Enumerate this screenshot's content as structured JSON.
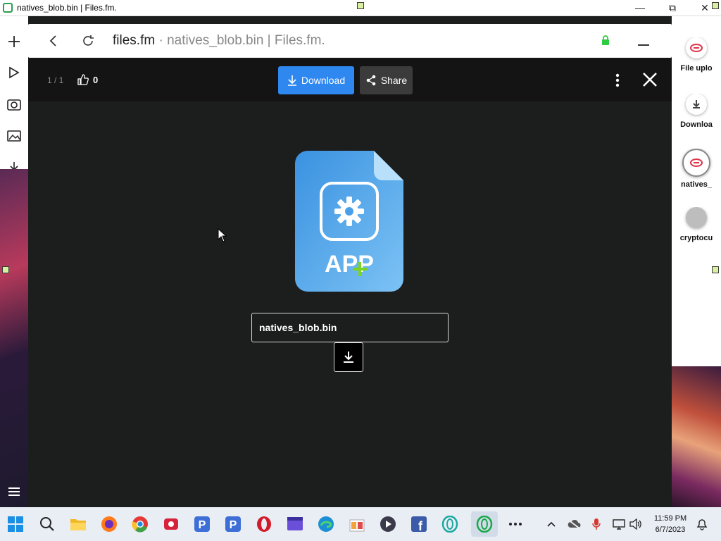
{
  "window": {
    "title": "natives_blob.bin | Files.fm."
  },
  "address_bar": {
    "domain": "files.fm",
    "separator": " · ",
    "page_title": "natives_blob.bin | Files.fm."
  },
  "viewer": {
    "counter": "1 / 1",
    "likes": "0",
    "download_label": "Download",
    "share_label": "Share",
    "file_type_label": "APP",
    "file_name": "natives_blob.bin"
  },
  "right_panel": {
    "items": [
      {
        "label": "File uplo",
        "icon": "filesfm-logo-icon"
      },
      {
        "label": "Downloa",
        "icon": "download-icon"
      },
      {
        "label": "natives_",
        "icon": "filesfm-logo-icon"
      },
      {
        "label": "cryptocu",
        "icon": "grey-circle-icon"
      }
    ]
  },
  "taskbar": {
    "time": "11:59 PM",
    "date": "6/7/2023"
  },
  "colors": {
    "accent_blue": "#2f87f0",
    "viewer_bg": "#1c1d1d",
    "secure_green": "#2ecc40"
  }
}
